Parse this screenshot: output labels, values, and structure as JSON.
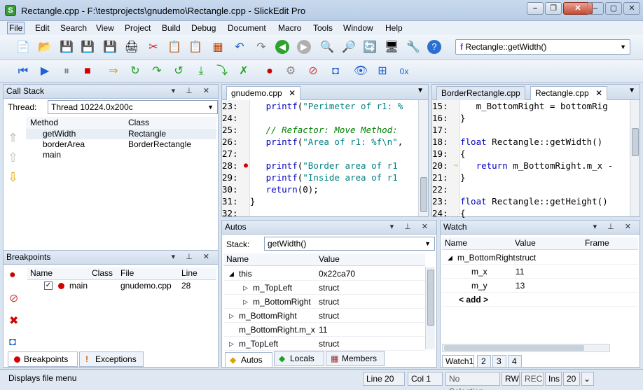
{
  "window": {
    "title": "Rectangle.cpp - F:\\testprojects\\gnudemo\\Rectangle.cpp - SlickEdit Pro",
    "minimize": "⎯",
    "restore": "❐",
    "close": "✕"
  },
  "menu": [
    "File",
    "Edit",
    "Search",
    "View",
    "Project",
    "Build",
    "Debug",
    "Document",
    "Macro",
    "Tools",
    "Window",
    "Help"
  ],
  "toolbar": {
    "function_combo": "Rectangle::getWidth()"
  },
  "call_stack": {
    "title": "Call Stack",
    "thread_label": "Thread:",
    "thread_value": "Thread 10224.0x200c",
    "columns": [
      "Method",
      "Class"
    ],
    "rows": [
      [
        "getWidth",
        "Rectangle"
      ],
      [
        "borderArea",
        "BorderRectangle"
      ],
      [
        "main",
        ""
      ]
    ]
  },
  "breakpoints": {
    "title": "Breakpoints",
    "columns": [
      "Name",
      "Class",
      "File",
      "Line"
    ],
    "rows": [
      {
        "name": "main",
        "class": "",
        "file": "gnudemo.cpp",
        "line": "28",
        "checked": true
      }
    ],
    "tabs": [
      "Breakpoints",
      "Exceptions"
    ]
  },
  "editor_left": {
    "tab": "gnudemo.cpp",
    "lines": [
      {
        "n": "23:",
        "code": "   printf(\"Perimeter of r1: %"
      },
      {
        "n": "24:",
        "code": ""
      },
      {
        "n": "25:",
        "code": "   // Refactor: Move Method:"
      },
      {
        "n": "26:",
        "code": "   printf(\"Area of r1: %f\\n\","
      },
      {
        "n": "27:",
        "code": ""
      },
      {
        "n": "28:",
        "code": "   printf(\"Border area of r1"
      },
      {
        "n": "29:",
        "code": "   printf(\"Inside area of r1"
      },
      {
        "n": "30:",
        "code": "   return(0);"
      },
      {
        "n": "31:",
        "code": "}"
      },
      {
        "n": "32:",
        "code": ""
      }
    ]
  },
  "editor_right": {
    "tabs": [
      "BorderRectangle.cpp",
      "Rectangle.cpp"
    ],
    "lines": [
      {
        "n": "15:",
        "code": "   m_BottomRight = bottomRig"
      },
      {
        "n": "16:",
        "code": "}"
      },
      {
        "n": "17:",
        "code": ""
      },
      {
        "n": "18:",
        "code": "float Rectangle::getWidth()"
      },
      {
        "n": "19:",
        "code": "{"
      },
      {
        "n": "20:",
        "code": "   return m_BottomRight.m_x -"
      },
      {
        "n": "21:",
        "code": "}"
      },
      {
        "n": "22:",
        "code": ""
      },
      {
        "n": "23:",
        "code": "float Rectangle::getHeight()"
      },
      {
        "n": "24:",
        "code": "{"
      }
    ]
  },
  "autos": {
    "title": "Autos",
    "stack_label": "Stack:",
    "stack_value": "getWidth()",
    "columns": [
      "Name",
      "Value"
    ],
    "rows": [
      {
        "name": "this",
        "value": "0x22ca70",
        "expander": "◢",
        "indent": 0
      },
      {
        "name": "m_TopLeft",
        "value": "struct",
        "expander": "▷",
        "indent": 1
      },
      {
        "name": "m_BottomRight",
        "value": "struct",
        "expander": "▷",
        "indent": 1
      },
      {
        "name": "m_BottomRight",
        "value": "struct",
        "expander": "▷",
        "indent": 0
      },
      {
        "name": "m_BottomRight.m_x",
        "value": "11",
        "expander": "",
        "indent": 0
      },
      {
        "name": "m_TopLeft",
        "value": "struct",
        "expander": "▷",
        "indent": 0
      }
    ],
    "tabs": [
      "Autos",
      "Locals",
      "Members"
    ]
  },
  "watch": {
    "title": "Watch",
    "columns": [
      "Name",
      "Value",
      "Frame"
    ],
    "rows": [
      {
        "name": "m_BottomRight",
        "value": "struct",
        "indent": 0,
        "expander": "◢"
      },
      {
        "name": "m_x",
        "value": "11",
        "indent": 1,
        "expander": ""
      },
      {
        "name": "m_y",
        "value": "13",
        "indent": 1,
        "expander": ""
      },
      {
        "name": "< add >",
        "value": "",
        "indent": 0,
        "expander": ""
      }
    ],
    "tabs": [
      "Watch1",
      "2",
      "3",
      "4"
    ]
  },
  "status": {
    "message": "Displays file menu",
    "line": "Line 20",
    "col": "Col 1",
    "selection": "No Selection",
    "rw": "RW",
    "rec": "REC",
    "ins": "Ins",
    "num": "20"
  },
  "colors": {
    "accent": "#0000c0",
    "string": "#008080",
    "comment": "#008000",
    "breakpoint": "#d40000"
  }
}
